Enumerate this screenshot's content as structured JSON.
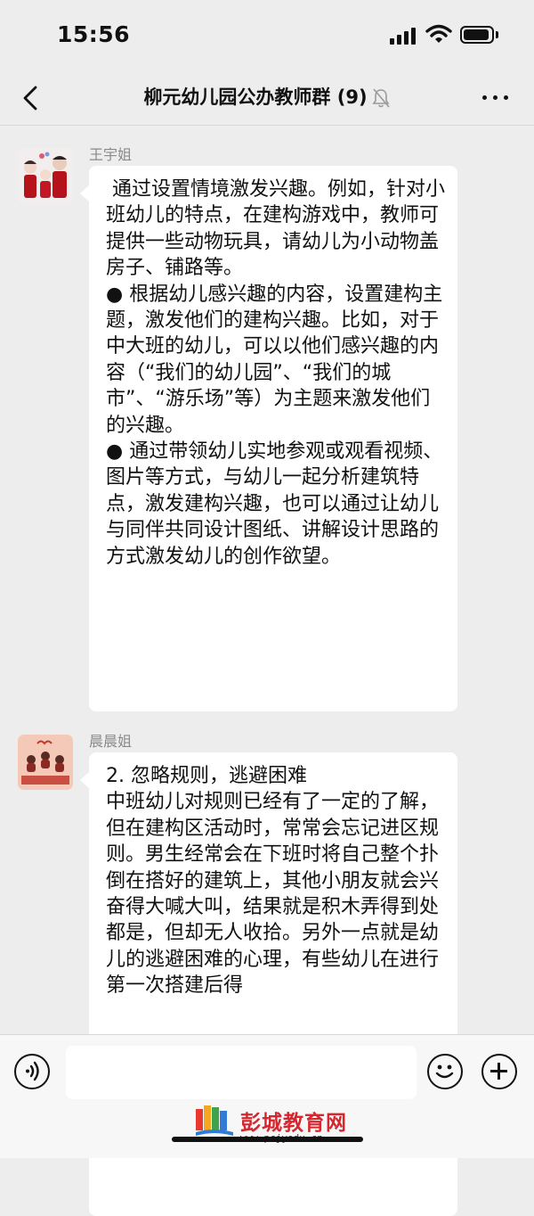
{
  "status_bar": {
    "time": "15:56"
  },
  "header": {
    "title": "柳元幼儿园公办教师群 (9)"
  },
  "messages": [
    {
      "sender": "王宇姐",
      "text": " 通过设置情境激发兴趣。例如，针对小班幼儿的特点，在建构游戏中，教师可提供一些动物玩具，请幼儿为小动物盖房子、铺路等。\n● 根据幼儿感兴趣的内容，设置建构主题，激发他们的建构兴趣。比如，对于中大班的幼儿，可以以他们感兴趣的内容（“我们的幼儿园”、“我们的城市”、“游乐场”等）为主题来激发他们的兴趣。\n● 通过带领幼儿实地参观或观看视频、图片等方式，与幼儿一起分析建筑特点，激发建构兴趣，也可以通过让幼儿与同伴共同设计图纸、讲解设计思路的方式激发幼儿的创作欲望。"
    },
    {
      "sender": "晨晨姐",
      "text": "2. 忽略规则，逃避困难\n中班幼儿对规则已经有了一定的了解，但在建构区活动时，常常会忘记进区规则。男生经常会在下班时将自己整个扑倒在搭好的建筑上，其他小朋友就会兴奋得大喊大叫，结果就是积木弄得到处都是，但却无人收拾。另外一点就是幼儿的逃避困难的心理，有些幼儿在进行第一次搭建后得"
    }
  ],
  "input": {
    "placeholder": ""
  },
  "watermark": {
    "title": "彭城教育网",
    "url": "www.pcjyedu.cn"
  },
  "icons": {
    "back": "chevron-left-icon",
    "mute": "bell-off-icon",
    "more": "ellipsis-icon",
    "voice": "voice-icon",
    "emoji": "smiley-icon",
    "plus": "plus-icon"
  },
  "colors": {
    "background": "#EDEDED",
    "bubble": "#FFFFFF",
    "watermark_red": "#D6262E"
  }
}
